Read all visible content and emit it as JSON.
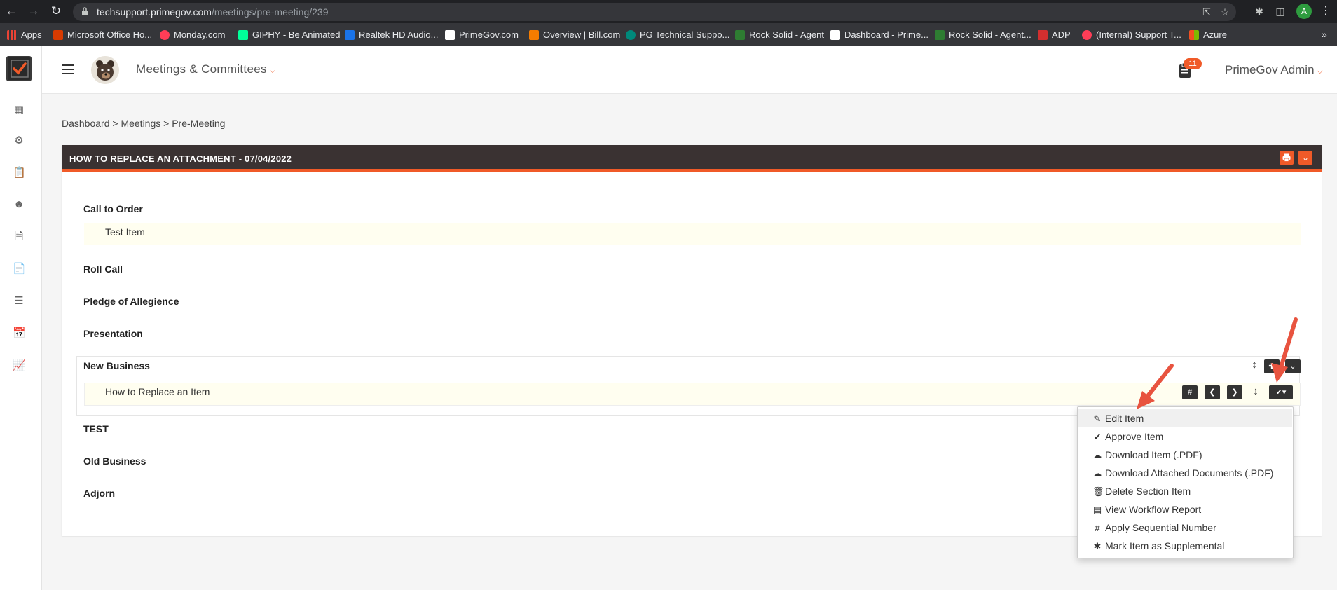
{
  "browser": {
    "url_host": "techsupport.primegov.com",
    "url_path": "/meetings/pre-meeting/239",
    "profile_initial": "A",
    "bookmarks": [
      {
        "label": "Apps",
        "color": "#4285f4"
      },
      {
        "label": "Microsoft Office Ho...",
        "color": "#d83b01"
      },
      {
        "label": "Monday.com",
        "color": "#ff3d57"
      },
      {
        "label": "GIPHY - Be Animated",
        "color": "#00ff99"
      },
      {
        "label": "Realtek HD Audio...",
        "color": "#1a73e8"
      },
      {
        "label": "PrimeGov.com",
        "color": "#ffffff"
      },
      {
        "label": "Overview | Bill.com",
        "color": "#f57c00"
      },
      {
        "label": "PG Technical Suppo...",
        "color": "#00897b"
      },
      {
        "label": "Rock Solid - Agent",
        "color": "#2e7d32"
      },
      {
        "label": "Dashboard - Prime...",
        "color": "#ffffff"
      },
      {
        "label": "Rock Solid - Agent...",
        "color": "#2e7d32"
      },
      {
        "label": "ADP",
        "color": "#d32f2f"
      },
      {
        "label": "(Internal) Support T...",
        "color": "#ff3d57"
      },
      {
        "label": "Azure",
        "color": "#f25022"
      }
    ]
  },
  "topbar": {
    "app_title": "Meetings & Committees",
    "notification_count": "11",
    "user_name": "PrimeGov Admin"
  },
  "breadcrumb": "Dashboard > Meetings > Pre-Meeting",
  "meeting": {
    "title": "HOW TO REPLACE AN ATTACHMENT - 07/04/2022",
    "sections": {
      "call_to_order": "Call to Order",
      "test_item": "Test Item",
      "roll_call": "Roll Call",
      "pledge": "Pledge of Allegience",
      "presentation": "Presentation",
      "new_business": "New Business",
      "replace_item": "How to Replace an Item",
      "test": "TEST",
      "old_business": "Old Business",
      "adjorn": "Adjorn"
    }
  },
  "item_actions": {
    "number_label": "#"
  },
  "dropdown": {
    "items": [
      {
        "label": "Edit Item",
        "icon": "edit-icon"
      },
      {
        "label": "Approve Item",
        "icon": "check-icon"
      },
      {
        "label": "Download Item (.PDF)",
        "icon": "cloud-download-icon"
      },
      {
        "label": "Download Attached Documents (.PDF)",
        "icon": "cloud-download-icon"
      },
      {
        "label": "Delete Section Item",
        "icon": "trash-icon"
      },
      {
        "label": "View Workflow Report",
        "icon": "report-icon"
      },
      {
        "label": "Apply Sequential Number",
        "icon": "hash-icon"
      },
      {
        "label": "Mark Item as Supplemental",
        "icon": "asterisk-icon"
      }
    ]
  },
  "colors": {
    "accent": "#f05a28",
    "header_dark": "#3a3232",
    "item_highlight": "#fffef0",
    "annotation_arrow": "#e8533f"
  }
}
